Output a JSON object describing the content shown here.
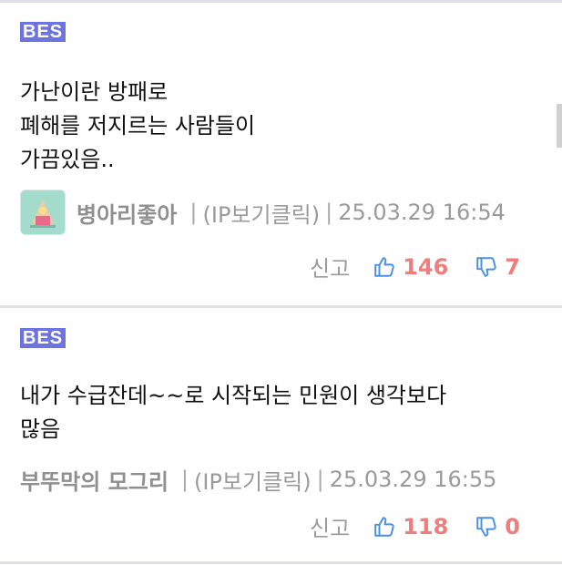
{
  "colors": {
    "badge_bg": "#6d74e2",
    "count": "#f07c7c",
    "thumb_icon": "#4a90e2",
    "divider": "#dfe1e6"
  },
  "comments": [
    {
      "badge": "BES",
      "text": "가난이란 방패로\n폐해를 저지르는 사람들이\n가끔있음..",
      "author": "병아리좋아",
      "has_avatar": true,
      "sep1": "|",
      "ip": "(IP보기클릭)",
      "sep2": "|",
      "date": "25.03.29 16:54",
      "report": "신고",
      "like_icon": "thumbs-up-icon",
      "likes": "146",
      "dislike_icon": "thumbs-down-icon",
      "dislikes": "7"
    },
    {
      "badge": "BES",
      "text": "내가 수급잔데~~로 시작되는 민원이 생각보다\n많음",
      "author": "부뚜막의 모그리",
      "has_avatar": false,
      "sep1": "|",
      "ip": "(IP보기클릭)",
      "sep2": "|",
      "date": "25.03.29 16:55",
      "report": "신고",
      "like_icon": "thumbs-up-icon",
      "likes": "118",
      "dislike_icon": "thumbs-down-icon",
      "dislikes": "0"
    }
  ]
}
